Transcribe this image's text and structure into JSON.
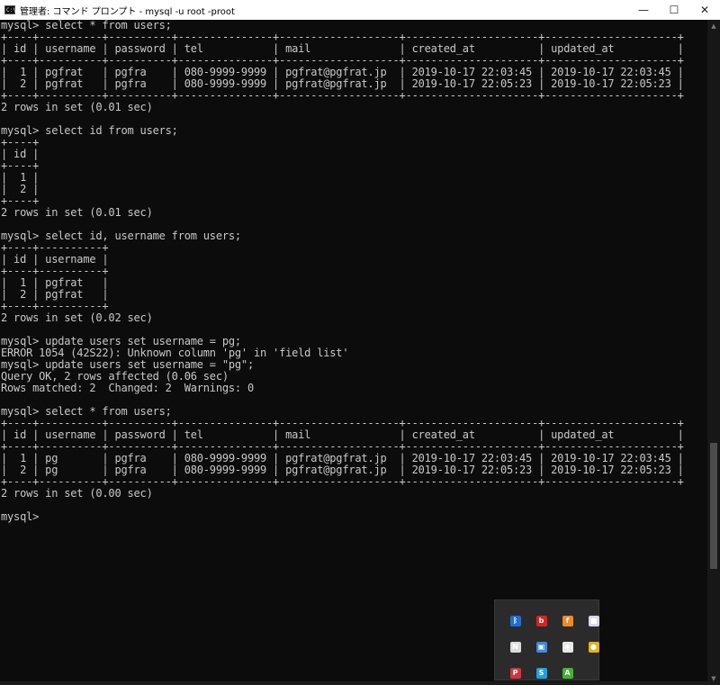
{
  "window": {
    "icon_label": "C:\\",
    "title": "管理者: コマンド プロンプト - mysql  -u root -proot",
    "minimize_glyph": "—",
    "maximize_glyph": "☐",
    "close_glyph": "✕"
  },
  "console_lines": [
    "mysql> select * from users;",
    "+----+----------+----------+---------------+-------------------+---------------------+---------------------+",
    "| id | username | password | tel           | mail              | created_at          | updated_at          |",
    "+----+----------+----------+---------------+-------------------+---------------------+---------------------+",
    "|  1 | pgfrat   | pgfra    | 080-9999-9999 | pgfrat@pgfrat.jp  | 2019-10-17 22:03:45 | 2019-10-17 22:03:45 |",
    "|  2 | pgfrat   | pgfra    | 080-9999-9999 | pgfrat@pgfrat.jp  | 2019-10-17 22:05:23 | 2019-10-17 22:05:23 |",
    "+----+----------+----------+---------------+-------------------+---------------------+---------------------+",
    "2 rows in set (0.01 sec)",
    "",
    "mysql> select id from users;",
    "+----+",
    "| id |",
    "+----+",
    "|  1 |",
    "|  2 |",
    "+----+",
    "2 rows in set (0.01 sec)",
    "",
    "mysql> select id, username from users;",
    "+----+----------+",
    "| id | username |",
    "+----+----------+",
    "|  1 | pgfrat   |",
    "|  2 | pgfrat   |",
    "+----+----------+",
    "2 rows in set (0.02 sec)",
    "",
    "mysql> update users set username = pg;",
    "ERROR 1054 (42S22): Unknown column 'pg' in 'field list'",
    "mysql> update users set username = \"pg\";",
    "Query OK, 2 rows affected (0.06 sec)",
    "Rows matched: 2  Changed: 2  Warnings: 0",
    "",
    "mysql> select * from users;",
    "+----+----------+----------+---------------+-------------------+---------------------+---------------------+",
    "| id | username | password | tel           | mail              | created_at          | updated_at          |",
    "+----+----------+----------+---------------+-------------------+---------------------+---------------------+",
    "|  1 | pg       | pgfra    | 080-9999-9999 | pgfrat@pgfrat.jp  | 2019-10-17 22:03:45 | 2019-10-17 22:03:45 |",
    "|  2 | pg       | pgfra    | 080-9999-9999 | pgfrat@pgfrat.jp  | 2019-10-17 22:05:23 | 2019-10-17 22:05:23 |",
    "+----+----------+----------+---------------+-------------------+---------------------+---------------------+",
    "2 rows in set (0.00 sec)",
    "",
    "mysql>"
  ],
  "scrollbar": {
    "up_glyph": "▲",
    "down_glyph": "▼"
  },
  "tray_icons": [
    {
      "name": "bluetooth-icon",
      "glyph": "ᛒ",
      "color": "#1e6fd9"
    },
    {
      "name": "beats-icon",
      "glyph": "b",
      "color": "#e02020"
    },
    {
      "name": "flash-app-icon",
      "glyph": "f",
      "color": "#f08a24"
    },
    {
      "name": "photos-app-icon",
      "glyph": "■",
      "color": "#d8d8e8"
    },
    {
      "name": "notepad-app-icon",
      "glyph": "N",
      "color": "#dcdcdc"
    },
    {
      "name": "monitor-app-icon",
      "glyph": "▣",
      "color": "#3a8be0"
    },
    {
      "name": "security-shield-icon",
      "glyph": "◈",
      "color": "#e8e8e8"
    },
    {
      "name": "chrome-icon",
      "glyph": "●",
      "color": "#e2b320"
    },
    {
      "name": "pdf-app-icon",
      "glyph": "P",
      "color": "#e0303a"
    },
    {
      "name": "skype-icon",
      "glyph": "S",
      "color": "#1da1e8"
    },
    {
      "name": "nvidia-icon",
      "glyph": "A",
      "color": "#3fb52f"
    }
  ]
}
